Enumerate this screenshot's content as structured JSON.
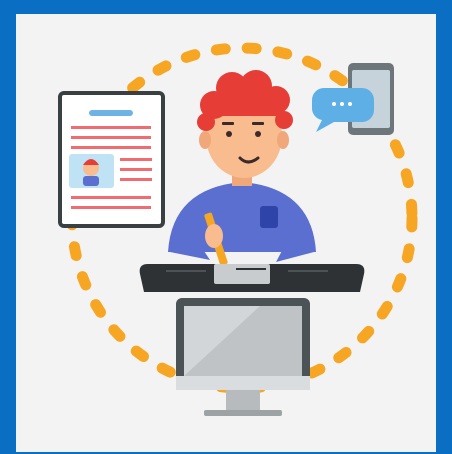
{
  "colors": {
    "frame": "#0A6FC2",
    "panel": "#F3F3F3",
    "dashes": "#F6A623",
    "hair": "#E63E36",
    "skin": "#F8BC8E",
    "shirt": "#5B6FD0",
    "desk": "#2E3235",
    "paper": "#C8CCCF",
    "doc_lines": "#F06C70",
    "doc_bar": "#6FB3E6",
    "bubble": "#5DAFE6",
    "phone_screen": "#C7D3DA",
    "phone_body": "#6D767A",
    "monitor_frame": "#4C5357",
    "monitor_screen": "#BFC3C6",
    "stand": "#B7BBBE",
    "pencil": "#F5A623"
  },
  "icons": {
    "document": "resume-document-icon",
    "phone": "smartphone-icon",
    "chat": "chat-bubble-icon",
    "computer": "desktop-monitor-icon",
    "person": "person-writing-illustration"
  }
}
